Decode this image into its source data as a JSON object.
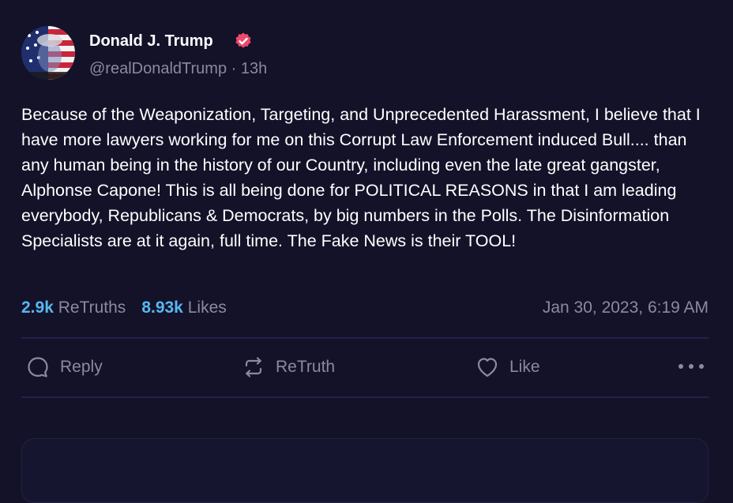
{
  "author": {
    "display_name": "Donald J. Trump",
    "handle": "@realDonaldTrump",
    "time_ago": "13h",
    "separator": "·",
    "verified": true
  },
  "post": {
    "text": "Because of the Weaponization, Targeting, and Unprecedented Harassment, I believe that I have more lawyers working for me on this Corrupt Law Enforcement induced Bull.... than any human being in the history of our Country, including even the late great gangster, Alphonse Capone! This is all being done for POLITICAL REASONS in that I am leading everybody, Republicans & Democrats, by big numbers in the Polls. The Disinformation Specialists are at it again, full time. The Fake News is their TOOL!",
    "retruths_count": "2.9k",
    "retruths_label": "ReTruths",
    "likes_count": "8.93k",
    "likes_label": "Likes",
    "timestamp": "Jan 30, 2023, 6:19 AM"
  },
  "actions": {
    "reply": "Reply",
    "retruth": "ReTruth",
    "like": "Like"
  },
  "icons": {
    "reply": "speech-bubble-icon",
    "retruth": "repost-arrows-icon",
    "like": "heart-icon",
    "more": "ellipsis-icon",
    "verified": "verified-badge-icon"
  },
  "colors": {
    "background": "#141229",
    "accent": "#57b7f3",
    "muted": "#8a8aa0",
    "verified": "#ee4a6b",
    "divider": "#22214a"
  }
}
